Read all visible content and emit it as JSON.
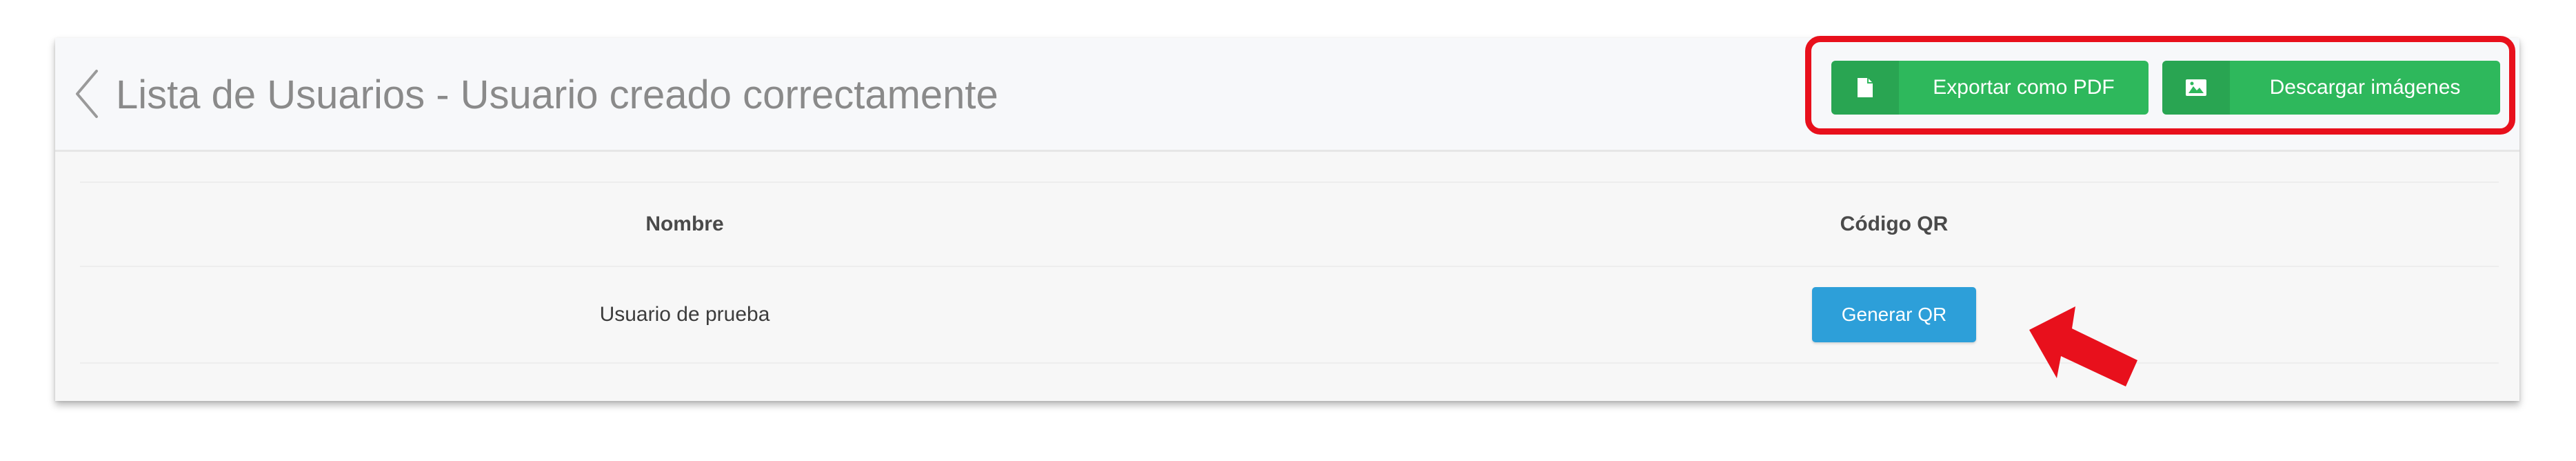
{
  "header": {
    "back_icon": "chevron-left-icon",
    "title": "Lista de Usuarios - Usuario creado correctamente",
    "actions": [
      {
        "label": "Exportar como PDF",
        "icon": "file-icon"
      },
      {
        "label": "Descargar imágenes",
        "icon": "image-icon"
      }
    ]
  },
  "table": {
    "columns": [
      "Nombre",
      "Código QR"
    ],
    "rows": [
      {
        "nombre": "Usuario de prueba",
        "action_label": "Generar QR"
      }
    ]
  },
  "colors": {
    "title_gray": "#8a8a8a",
    "green_button": "#2eb85c",
    "blue_button": "#2d9fd9",
    "annotation_red": "#e8101c"
  }
}
